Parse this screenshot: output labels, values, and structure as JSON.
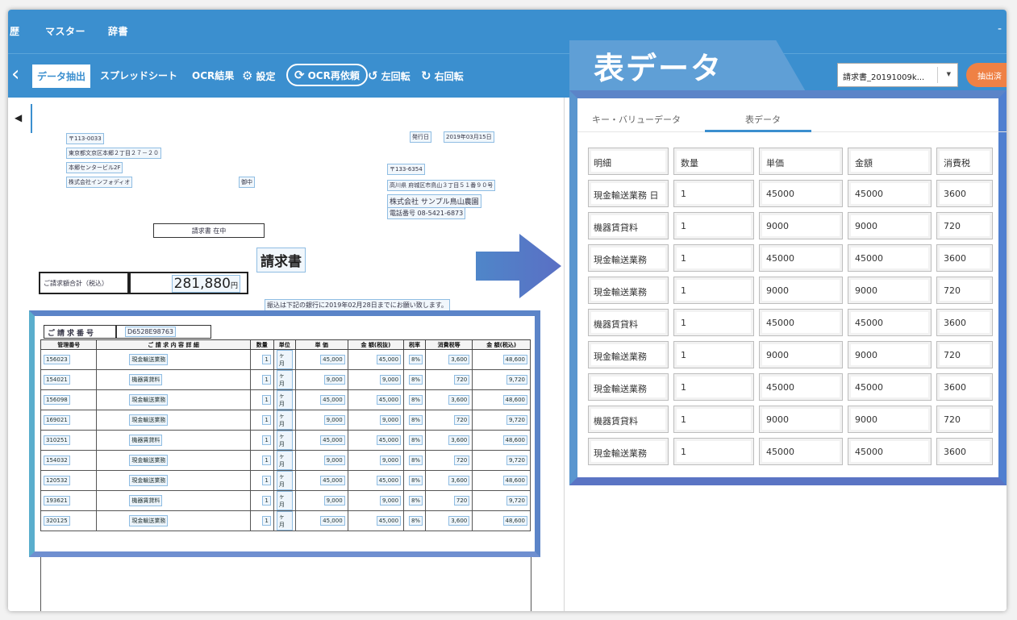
{
  "topnav": {
    "items": [
      "歴",
      "マスター",
      "辞書"
    ],
    "dash": "-"
  },
  "toolbar": {
    "back_icon": "chevron-left-icon",
    "data_extract": "データ抽出",
    "spreadsheet": "スプレッドシート",
    "ocr_result": "OCR結果",
    "settings": "設定",
    "ocr_retry": "OCR再依頼",
    "rotate_left": "左回転",
    "rotate_right": "右回転"
  },
  "right_panel": {
    "title": "表データ",
    "file_name": "請求書_20191009k...",
    "extract_button": "抽出済",
    "tabs": [
      {
        "label": "キー・バリューデータ"
      },
      {
        "label": "表データ"
      }
    ],
    "table": {
      "headers": [
        "明細",
        "数量",
        "単価",
        "金額",
        "消費税"
      ],
      "rows": [
        [
          "現金輸送業務 日",
          "1",
          "45000",
          "45000",
          "3600"
        ],
        [
          "機器賃貸料",
          "1",
          "9000",
          "9000",
          "720"
        ],
        [
          "現金輸送業務",
          "1",
          "45000",
          "45000",
          "3600"
        ],
        [
          "現金輸送業務",
          "1",
          "9000",
          "9000",
          "720"
        ],
        [
          "機器賃貸料",
          "1",
          "45000",
          "45000",
          "3600"
        ],
        [
          "現金輸送業務",
          "1",
          "9000",
          "9000",
          "720"
        ],
        [
          "現金輸送業務",
          "1",
          "45000",
          "45000",
          "3600"
        ],
        [
          "機器賃貸料",
          "1",
          "9000",
          "9000",
          "720"
        ],
        [
          "現金輸送業務",
          "1",
          "45000",
          "45000",
          "3600"
        ]
      ]
    }
  },
  "document": {
    "postal_left": "〒113-0033",
    "address_left": "東京都文京区本郷２丁目２７－２０",
    "building_left": "本郷センタービル2F",
    "company_left": "株式会社インフォディオ",
    "onchu": "御中",
    "issue_label": "発行日",
    "issue_date": "2019年03月15日",
    "postal_right": "〒133-6354",
    "address_right": "高川県 府城区市鳥山３丁目５１番９０号",
    "company_right": "株式会社 サンプル鳥山農園",
    "tel_right": "電話番号 08-5421-6873",
    "sub_title": "請求書 在中",
    "title": "請求書",
    "total_label": "ご請求額合計（税込）",
    "total_value": "281,880",
    "total_unit": "円",
    "note": "振込は下記の銀行に2019年02月28日までにお願い致します。",
    "invoice_no_label": "ご請求番号",
    "invoice_no": "D6528E98763",
    "table_headers": [
      "管理番号",
      "ご 請 求 内 容 詳 細",
      "数量",
      "単位",
      "単 価",
      "金 額(税抜)",
      "税率",
      "消費税等",
      "金 額(税込)"
    ],
    "table_rows": [
      [
        "156023",
        "現金輸送業務",
        "1",
        "ヶ月",
        "45,000",
        "45,000",
        "8%",
        "3,600",
        "48,600"
      ],
      [
        "154021",
        "機器賃貸料",
        "1",
        "ヶ月",
        "9,000",
        "9,000",
        "8%",
        "720",
        "9,720"
      ],
      [
        "156098",
        "現金輸送業務",
        "1",
        "ヶ月",
        "45,000",
        "45,000",
        "8%",
        "3,600",
        "48,600"
      ],
      [
        "169021",
        "現金輸送業務",
        "1",
        "ヶ月",
        "9,000",
        "9,000",
        "8%",
        "720",
        "9,720"
      ],
      [
        "310251",
        "機器賃貸料",
        "1",
        "ヶ月",
        "45,000",
        "45,000",
        "8%",
        "3,600",
        "48,600"
      ],
      [
        "154032",
        "現金輸送業務",
        "1",
        "ヶ月",
        "9,000",
        "9,000",
        "8%",
        "720",
        "9,720"
      ],
      [
        "120532",
        "現金輸送業務",
        "1",
        "ヶ月",
        "45,000",
        "45,000",
        "8%",
        "3,600",
        "48,600"
      ],
      [
        "193621",
        "機器賃貸料",
        "1",
        "ヶ月",
        "9,000",
        "9,000",
        "8%",
        "720",
        "9,720"
      ],
      [
        "320125",
        "現金輸送業務",
        "1",
        "ヶ月",
        "45,000",
        "45,000",
        "8%",
        "3,600",
        "48,600"
      ]
    ]
  },
  "colors": {
    "primary": "#3b8fcf",
    "accent": "#ef8145",
    "frame": "#5b84c8"
  }
}
